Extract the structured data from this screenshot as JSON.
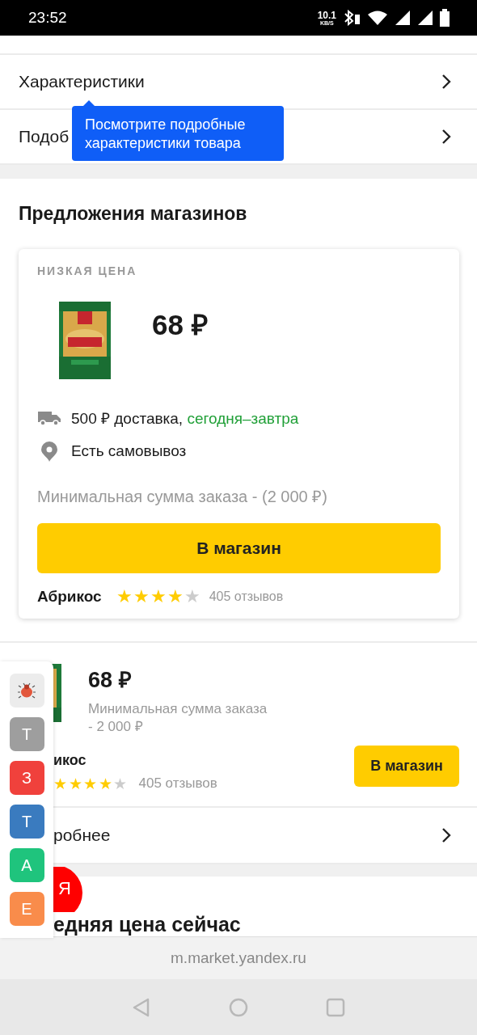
{
  "status_bar": {
    "time": "23:52",
    "speed": "10.1",
    "speed_unit": "KB/S"
  },
  "rows": [
    {
      "label": "Характеристики"
    },
    {
      "label": "Подоб"
    }
  ],
  "tooltip": {
    "text": "Посмотрите подробные характеристики товара"
  },
  "offers_section": {
    "title": "Предложения магазинов",
    "best_offer": {
      "badge": "НИЗКАЯ ЦЕНА",
      "price": "68 ₽",
      "delivery": "500 ₽ доставка,",
      "delivery_time": "сегодня–завтра",
      "pickup": "Есть самовывоз",
      "min_order": "Минимальная сумма заказа - (2 000 ₽)",
      "button": "В магазин",
      "shop": "Абрикос",
      "stars": 4,
      "reviews": "405 отзывов"
    },
    "offer": {
      "price": "68 ₽",
      "min_order": "Минимальная сумма заказа - 2 000 ₽",
      "shop": "икос",
      "stars": 4,
      "reviews": "405 отзывов",
      "button": "В магазин"
    },
    "more_row": {
      "label": "робнее"
    }
  },
  "next_section": {
    "title": "едняя цена сейчас"
  },
  "side_panel": {
    "tiles": [
      {
        "kind": "bug",
        "color": "#ececec"
      },
      {
        "kind": "letter",
        "letter": "Т",
        "color": "#9e9e9e"
      },
      {
        "kind": "letter",
        "letter": "З",
        "color": "#f0413c"
      },
      {
        "kind": "letter",
        "letter": "Т",
        "color": "#3a7bbf"
      },
      {
        "kind": "letter",
        "letter": "А",
        "color": "#1fc47d"
      },
      {
        "kind": "letter",
        "letter": "Е",
        "color": "#f98c4b"
      }
    ],
    "fab": "Я"
  },
  "url_bar": {
    "url": "m.market.yandex.ru"
  }
}
